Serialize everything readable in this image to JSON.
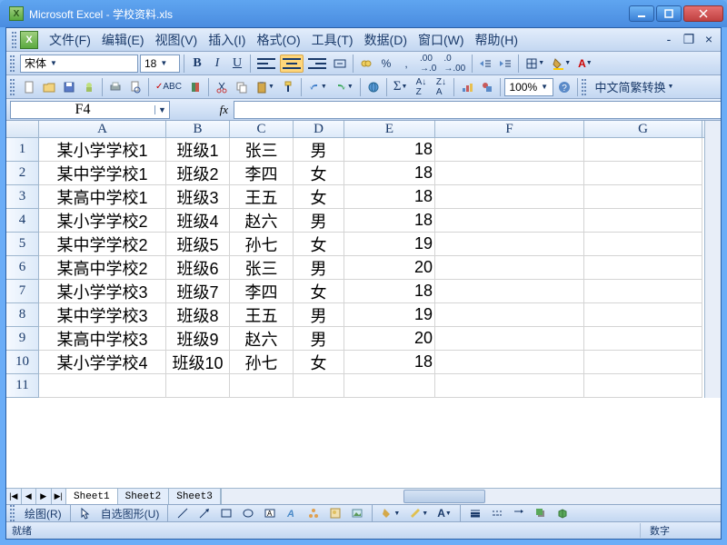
{
  "window": {
    "title": "Microsoft Excel - 学校资料.xls"
  },
  "menus": {
    "file": "文件(F)",
    "edit": "编辑(E)",
    "view": "视图(V)",
    "insert": "插入(I)",
    "format": "格式(O)",
    "tools": "工具(T)",
    "data": "数据(D)",
    "window": "窗口(W)",
    "help": "帮助(H)"
  },
  "fmt": {
    "font": "宋体",
    "size": "18"
  },
  "zoom": "100%",
  "convert": "中文简繁转换",
  "namebox": "F4",
  "draw": {
    "label": "绘图(R)",
    "autoshape": "自选图形(U)"
  },
  "columns": [
    "A",
    "B",
    "C",
    "D",
    "E",
    "F",
    "G"
  ],
  "colwidths": [
    "cwA",
    "cwB",
    "cwC",
    "cwD",
    "cwE",
    "cwF",
    "cwG"
  ],
  "rows": [
    {
      "h": "1",
      "c": [
        "某小学学校1",
        "班级1",
        "张三",
        "男",
        "18",
        "",
        ""
      ]
    },
    {
      "h": "2",
      "c": [
        "某中学学校1",
        "班级2",
        "李四",
        "女",
        "18",
        "",
        ""
      ]
    },
    {
      "h": "3",
      "c": [
        "某高中学校1",
        "班级3",
        "王五",
        "女",
        "18",
        "",
        ""
      ]
    },
    {
      "h": "4",
      "c": [
        "某小学学校2",
        "班级4",
        "赵六",
        "男",
        "18",
        "",
        ""
      ]
    },
    {
      "h": "5",
      "c": [
        "某中学学校2",
        "班级5",
        "孙七",
        "女",
        "19",
        "",
        ""
      ]
    },
    {
      "h": "6",
      "c": [
        "某高中学校2",
        "班级6",
        "张三",
        "男",
        "20",
        "",
        ""
      ]
    },
    {
      "h": "7",
      "c": [
        "某小学学校3",
        "班级7",
        "李四",
        "女",
        "18",
        "",
        ""
      ]
    },
    {
      "h": "8",
      "c": [
        "某中学学校3",
        "班级8",
        "王五",
        "男",
        "19",
        "",
        ""
      ]
    },
    {
      "h": "9",
      "c": [
        "某高中学校3",
        "班级9",
        "赵六",
        "男",
        "20",
        "",
        ""
      ]
    },
    {
      "h": "10",
      "c": [
        "某小学学校4",
        "班级10",
        "孙七",
        "女",
        "18",
        "",
        ""
      ]
    },
    {
      "h": "11",
      "c": [
        "",
        "",
        "",
        "",
        "",
        "",
        ""
      ]
    }
  ],
  "tabs": [
    "Sheet1",
    "Sheet2",
    "Sheet3"
  ],
  "status": {
    "ready": "就绪",
    "num": "数字"
  }
}
